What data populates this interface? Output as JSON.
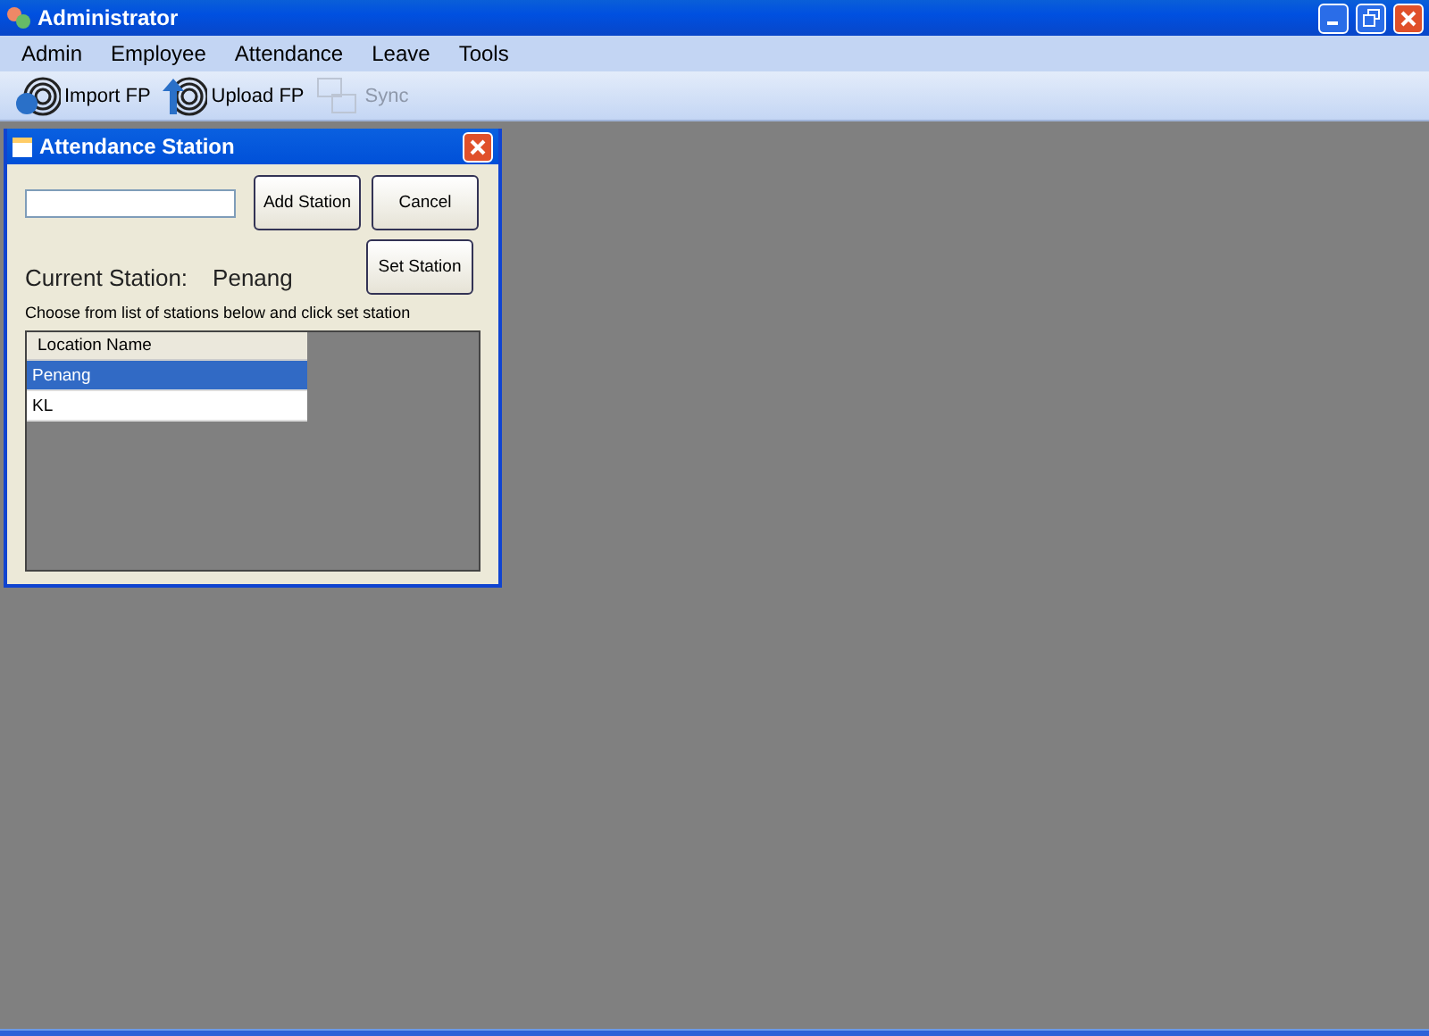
{
  "window": {
    "title": "Administrator"
  },
  "menu": [
    "Admin",
    "Employee",
    "Attendance",
    "Leave",
    "Tools"
  ],
  "toolbar": [
    {
      "label": "Import FP",
      "kind": "import",
      "disabled": false
    },
    {
      "label": "Upload FP",
      "kind": "upload",
      "disabled": false
    },
    {
      "label": "Sync",
      "kind": "sync",
      "disabled": true
    }
  ],
  "dialog": {
    "title": "Attendance Station",
    "buttons": [
      "Add Station",
      "Cancel",
      "Set Station"
    ],
    "current_label": "Current Station:",
    "current_value": "Penang",
    "hint": "Choose from list of stations below and click set station",
    "table": {
      "columns": [
        "Location Name"
      ],
      "rows": [
        {
          "cells": [
            "Penang"
          ],
          "selected": true
        },
        {
          "cells": [
            "KL"
          ],
          "selected": false
        }
      ]
    }
  }
}
